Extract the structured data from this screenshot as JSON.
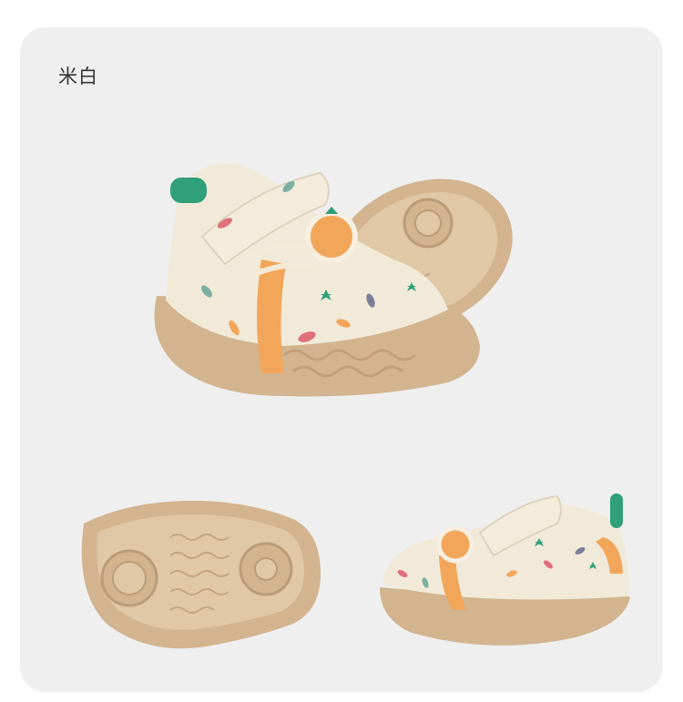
{
  "product": {
    "color_label": "米白"
  },
  "colors": {
    "card_background": "#efefef",
    "canvas_upper": "#cfcbc3",
    "sole_tan": "#d2b48f",
    "upper_cream": "#f1ead8",
    "accent_orange": "#f2a65a",
    "accent_green": "#2fa07a"
  },
  "images": [
    "front-three-quarter-view-with-sole",
    "sole-bottom-view",
    "side-profile-view"
  ]
}
